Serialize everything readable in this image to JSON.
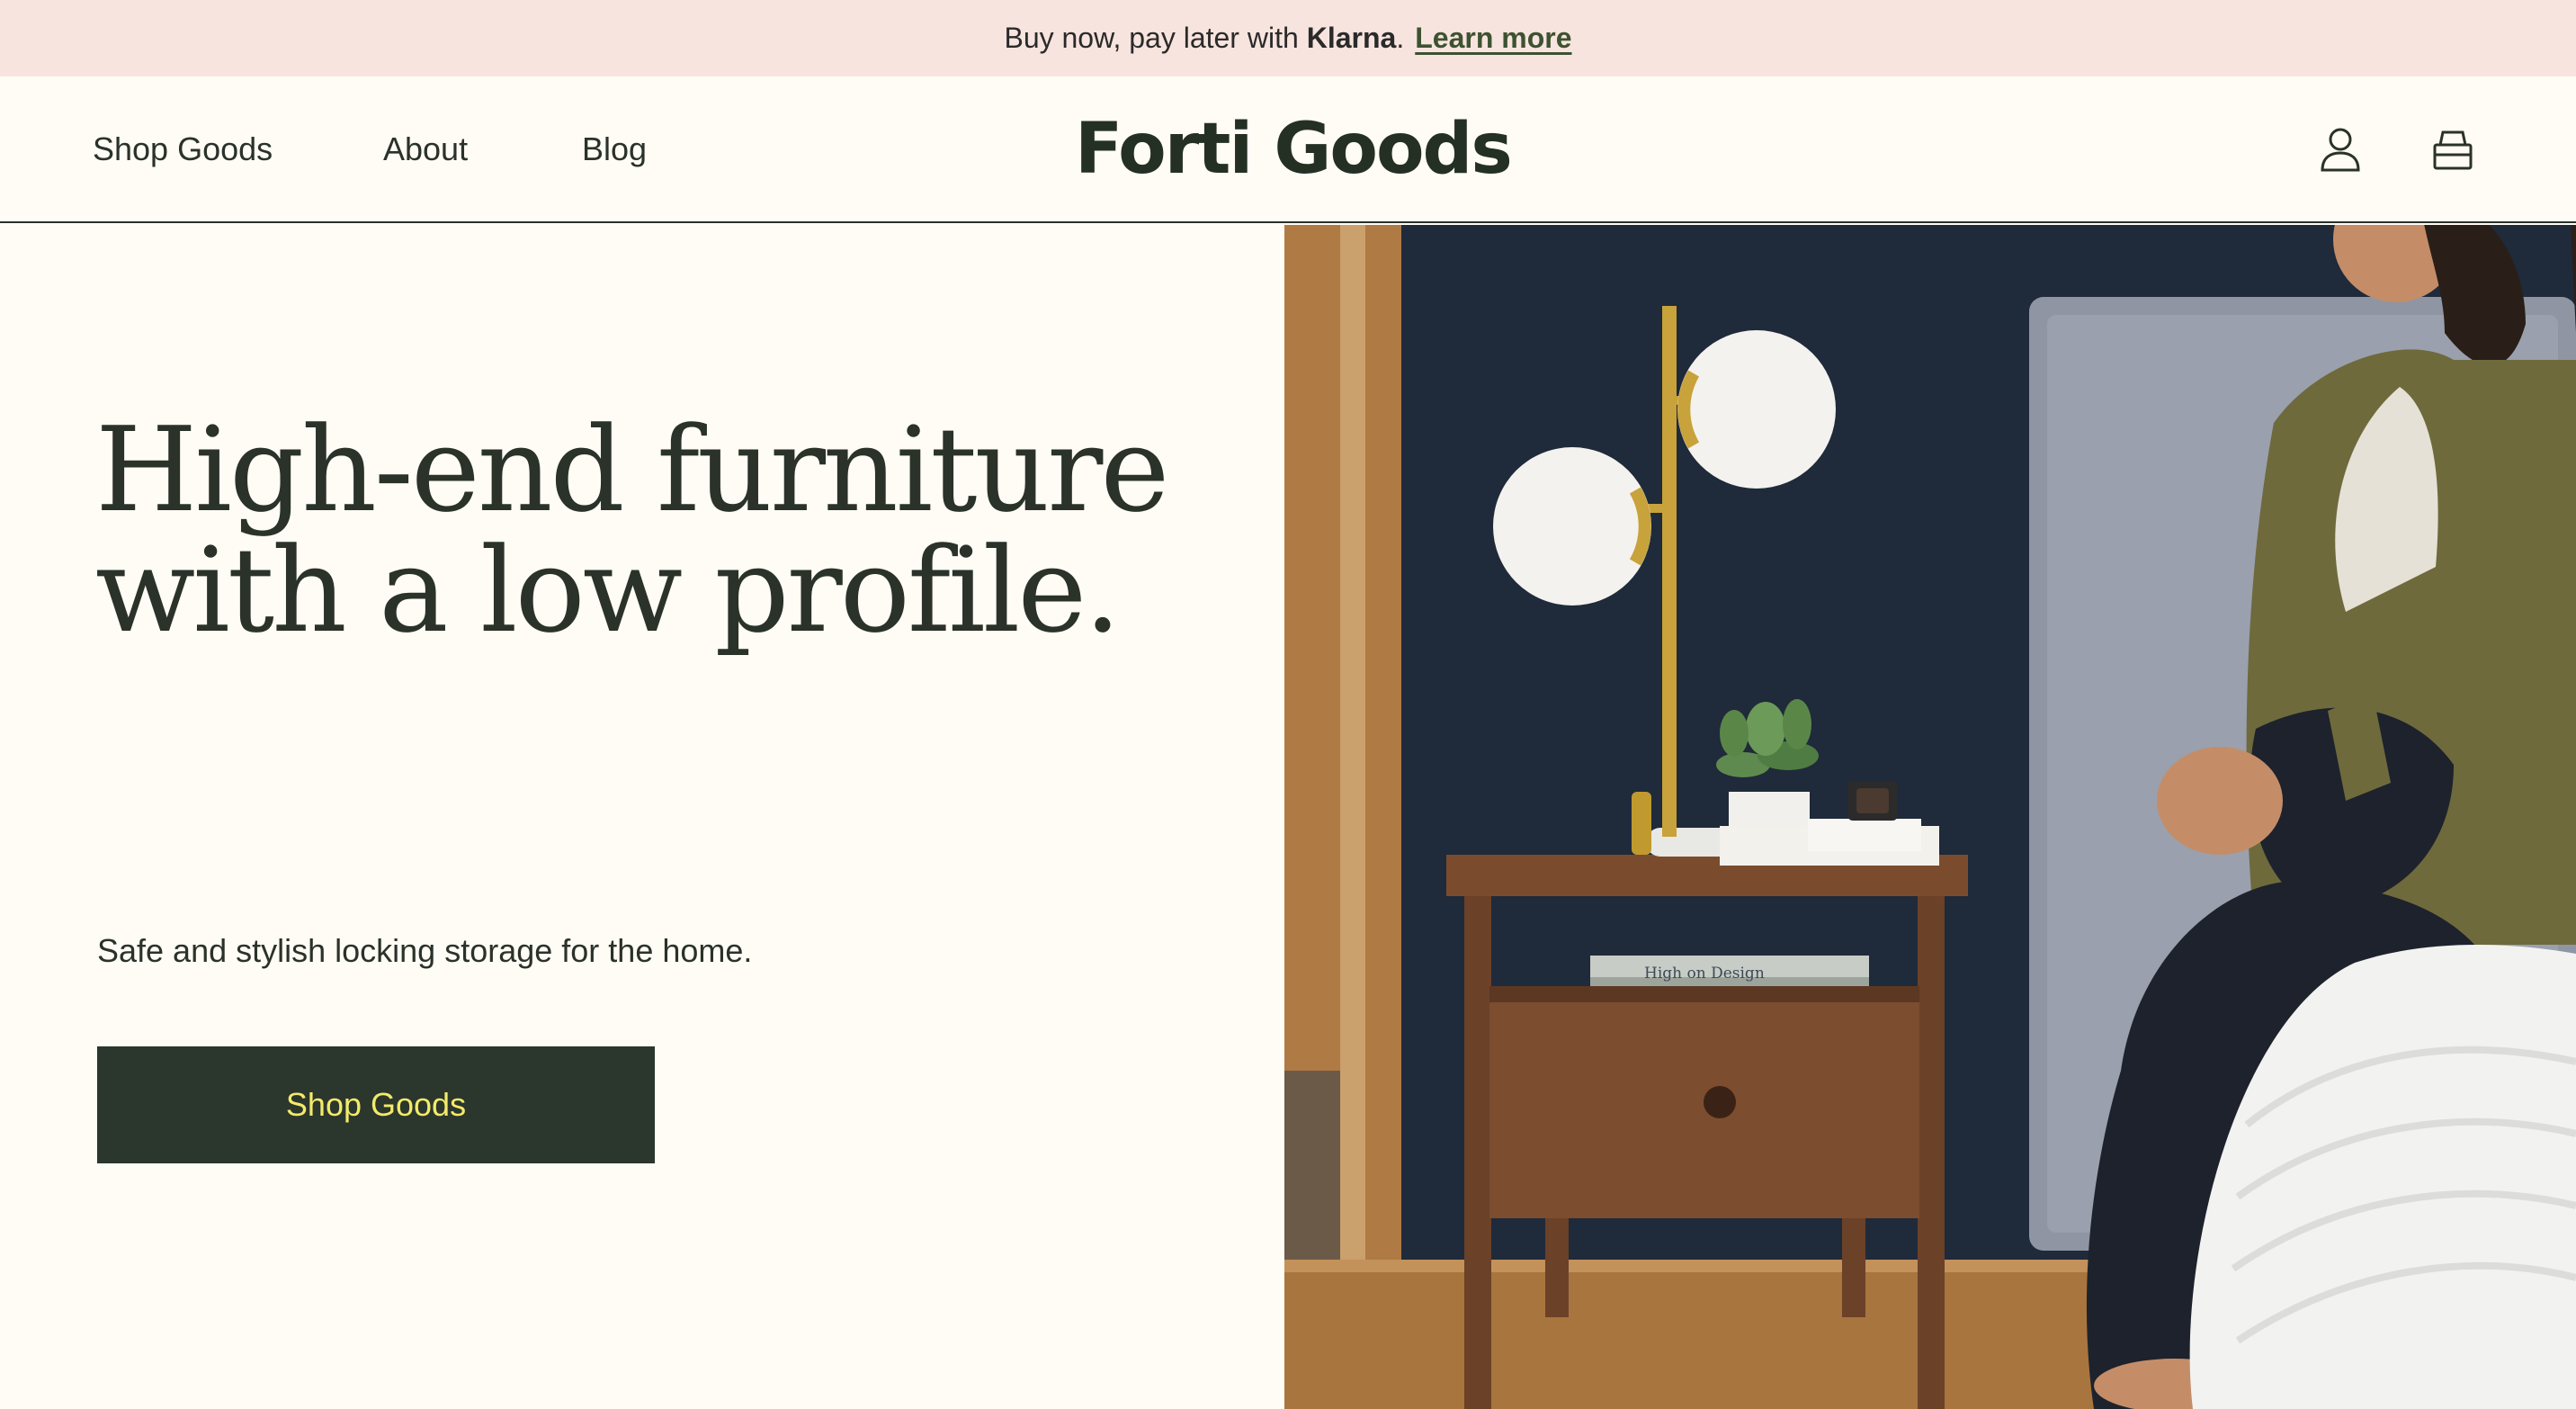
{
  "promo": {
    "text": "Buy now, pay later with",
    "brand": "Klarna",
    "link": "Learn more"
  },
  "header": {
    "nav": [
      "Shop Goods",
      "About",
      "Blog"
    ],
    "logo": "Forti Goods",
    "icons": [
      "account-icon",
      "cart-icon"
    ]
  },
  "hero": {
    "headline_line1": "High-end furniture",
    "headline_line2": "with a low profile.",
    "subhead": "Safe and stylish locking storage for the home.",
    "cta": "Shop Goods",
    "photo": {
      "book_title": "High on Design"
    }
  },
  "colors": {
    "promo_bg": "#f8e4df",
    "page_bg": "#fffcf5",
    "dark_green": "#2b362c",
    "cta_text": "#f3ea6a",
    "link_green": "#3d5231"
  }
}
